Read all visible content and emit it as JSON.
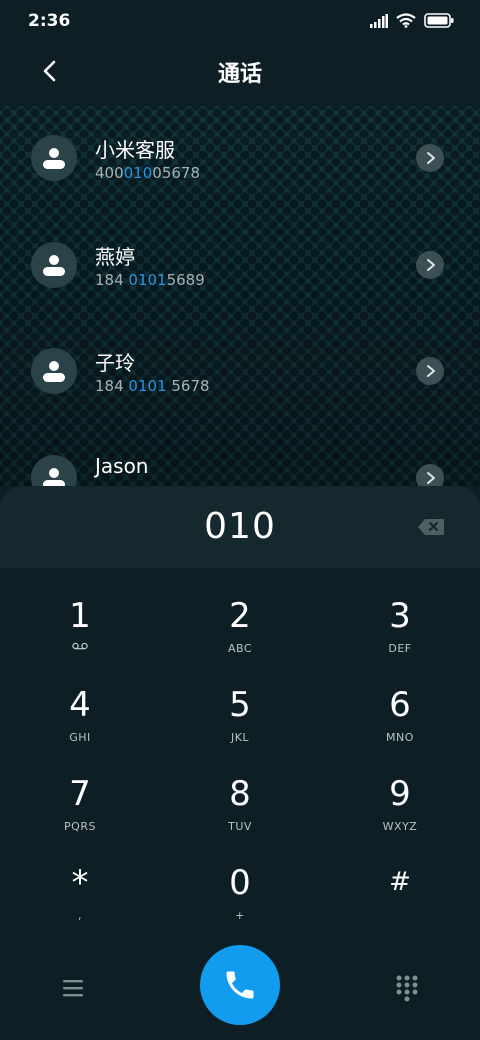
{
  "status_bar": {
    "time": "2:36",
    "icons": [
      "signal-icon",
      "wifi-icon",
      "battery-icon"
    ]
  },
  "header": {
    "title": "通话",
    "back_icon": "chevron-left-icon"
  },
  "contacts": [
    {
      "name": "小米客服",
      "num_pre": "400",
      "num_match": "010",
      "num_post": "05678"
    },
    {
      "name": "燕婷",
      "num_pre": "184 ",
      "num_match": "0101",
      "num_post": "5689"
    },
    {
      "name": "子玲",
      "num_pre": "184 ",
      "num_match": "0101",
      "num_post": " 5678"
    },
    {
      "name": "Jason",
      "num_pre": "",
      "num_match": "",
      "num_post": ""
    }
  ],
  "dialer": {
    "input_value": "010",
    "keys": [
      {
        "digit": "1",
        "letters": "voicemail-icon"
      },
      {
        "digit": "2",
        "letters": "ABC"
      },
      {
        "digit": "3",
        "letters": "DEF"
      },
      {
        "digit": "4",
        "letters": "GHI"
      },
      {
        "digit": "5",
        "letters": "JKL"
      },
      {
        "digit": "6",
        "letters": "MNO"
      },
      {
        "digit": "7",
        "letters": "PQRS"
      },
      {
        "digit": "8",
        "letters": "TUV"
      },
      {
        "digit": "9",
        "letters": "WXYZ"
      },
      {
        "digit": "*",
        "letters": ","
      },
      {
        "digit": "0",
        "letters": "+"
      },
      {
        "digit": "#",
        "letters": ""
      }
    ]
  },
  "colors": {
    "accent": "#119cf0",
    "match_highlight": "#2a95e4",
    "background": "#0d1e24"
  }
}
